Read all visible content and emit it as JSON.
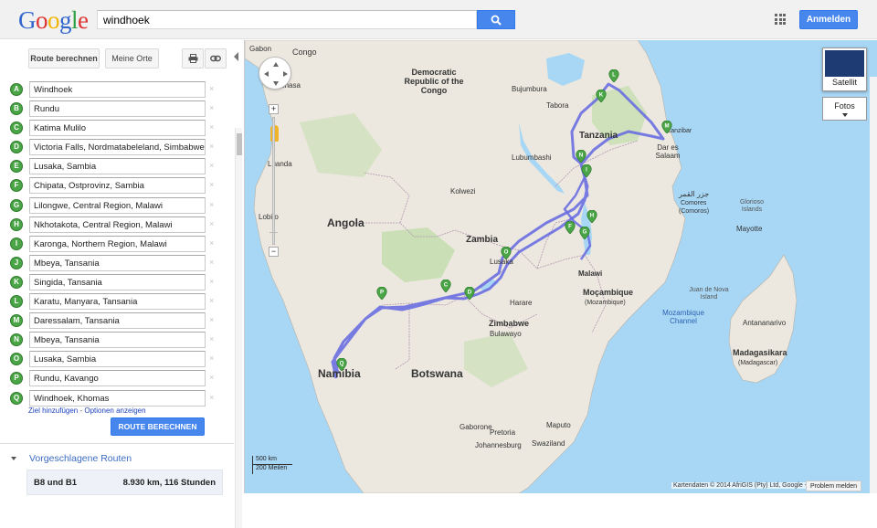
{
  "header": {
    "logo": "Google",
    "logo_colors": [
      "#3366cc",
      "#dd3333",
      "#f3b400",
      "#3366cc",
      "#2f9e44",
      "#dd3333"
    ],
    "search_value": "windhoek",
    "search_icon": "search-icon",
    "apps_icon": "apps-grid-icon",
    "signin_label": "Anmelden",
    "accent": "#4787ed"
  },
  "panel": {
    "route_button_label": "Route berechnen",
    "my_places_label": "Meine Orte",
    "print_icon": "print-icon",
    "link_icon": "link-icon",
    "waypoints": [
      {
        "letter": "A",
        "value": "Windhoek"
      },
      {
        "letter": "B",
        "value": "Rundu"
      },
      {
        "letter": "C",
        "value": "Katima Mulilo"
      },
      {
        "letter": "D",
        "value": "Victoria Falls, Nordmatabeleland, Simbabwe"
      },
      {
        "letter": "E",
        "value": "Lusaka, Sambia"
      },
      {
        "letter": "F",
        "value": "Chipata, Ostprovinz, Sambia"
      },
      {
        "letter": "G",
        "value": "Lilongwe, Central Region, Malawi"
      },
      {
        "letter": "H",
        "value": "Nkhotakota, Central Region, Malawi"
      },
      {
        "letter": "I",
        "value": "Karonga, Northern Region, Malawi"
      },
      {
        "letter": "J",
        "value": "Mbeya, Tansania"
      },
      {
        "letter": "K",
        "value": "Singida, Tansania"
      },
      {
        "letter": "L",
        "value": "Karatu, Manyara, Tansania"
      },
      {
        "letter": "M",
        "value": "Daressalam, Tansania"
      },
      {
        "letter": "N",
        "value": "Mbeya, Tansania"
      },
      {
        "letter": "O",
        "value": "Lusaka, Sambia"
      },
      {
        "letter": "P",
        "value": "Rundu, Kavango"
      },
      {
        "letter": "Q",
        "value": "Windhoek, Khomas"
      }
    ],
    "add_destination": "Ziel hinzufügen",
    "separator": " - ",
    "show_options": "Optionen anzeigen",
    "calc_button": "ROUTE BERECHNEN",
    "suggested_title": "Vorgeschlagene Routen",
    "route": {
      "name": "B8 und B1",
      "summary": "8.930 km, 116 Stunden"
    },
    "marker_color": "#4aa546"
  },
  "map": {
    "countries": {
      "angola": "Angola",
      "namibia": "Namibia",
      "botswana": "Botswana",
      "zambia": "Zambia",
      "zimbabwe": "Zimbabwe",
      "tanzania": "Tanzania",
      "drc": "Democratic Republic of the Congo",
      "congo": "Congo",
      "gabon": "Gabon",
      "mozambique": "Moçambique",
      "mozambique_sub": "(Mozambique)",
      "madagascar": "Madagasikara",
      "madagascar_sub": "(Madagascar)",
      "malawi": "Malawi",
      "comoros": "جزر القمر",
      "comoros_sub1": "Comores",
      "comoros_sub2": "(Comoros)"
    },
    "cities": {
      "kinshasa": "Kinshasa",
      "luanda": "Luanda",
      "lubumbashi": "Lubumbashi",
      "bujumbura": "Bujumbura",
      "kolwezi": "Kolwezi",
      "lusaka": "Lusaka",
      "harare": "Harare",
      "bulawayo": "Bulawayo",
      "gaborone": "Gaborone",
      "pretoria": "Pretoria",
      "johannesburg": "Johannesburg",
      "maputo": "Maputo",
      "swaziland": "Swaziland",
      "zanzibar": "Zanzibar",
      "dar": "Dar es Salaam",
      "mayotte": "Mayotte",
      "antananarivo": "Antananarivo",
      "glorioso": "Glorioso Islands",
      "juan_de_nova": "Juan de Nova Island",
      "mozambique_channel": "Mozambique Channel",
      "lobito": "Lobito",
      "tabora": "Tabora"
    },
    "pins": [
      "L",
      "K",
      "M",
      "N",
      "I",
      "F",
      "G",
      "H",
      "O",
      "C",
      "D",
      "P",
      "Q"
    ],
    "satellite_label": "Satellit",
    "photos_label": "Fotos",
    "scale_km": "500 km",
    "scale_mi": "200 Meilen",
    "copyright": "Kartendaten © 2014 AfriGIS (Pty) Ltd, Google -",
    "report": "Problem melden",
    "route_color": "#6a6ee0",
    "land_color": "#e9e5dc",
    "water_color": "#a8d7f5",
    "park_color": "#c7deb0"
  }
}
